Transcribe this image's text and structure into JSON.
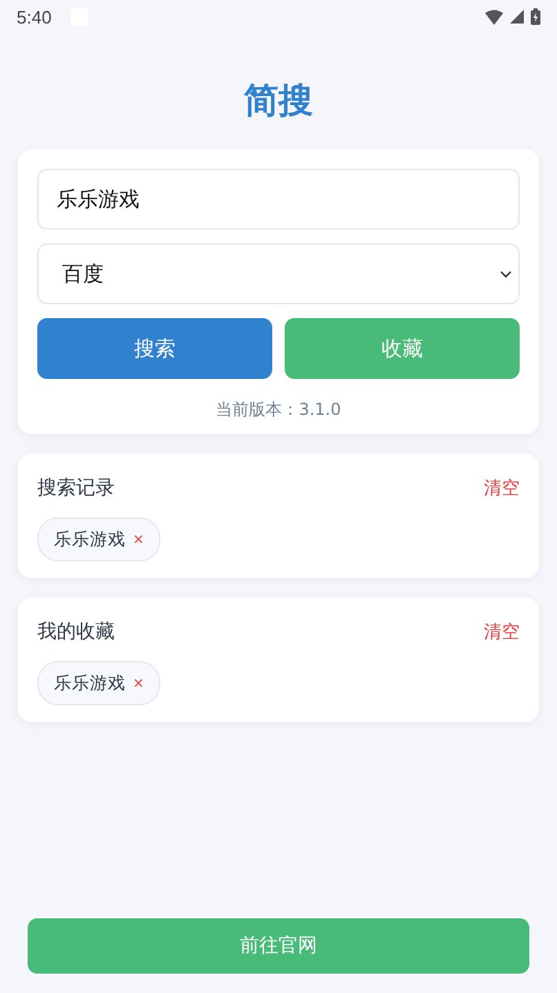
{
  "status_bar": {
    "time": "5:40"
  },
  "title": "简搜",
  "search": {
    "value": "乐乐游戏",
    "engine": "百度",
    "buttons": [
      {
        "label": "搜索",
        "kind": "primary"
      },
      {
        "label": "收藏",
        "kind": "secondary"
      }
    ],
    "version": "当前版本：3.1.0"
  },
  "sections": [
    {
      "title": "搜索记录",
      "action": "清空",
      "tags": [
        {
          "label": "乐乐游戏",
          "remove": "×"
        }
      ]
    },
    {
      "title": "我的收藏",
      "action": "清空",
      "tags": [
        {
          "label": "乐乐游戏",
          "remove": "×"
        }
      ]
    }
  ],
  "footer_button": "前往官网"
}
